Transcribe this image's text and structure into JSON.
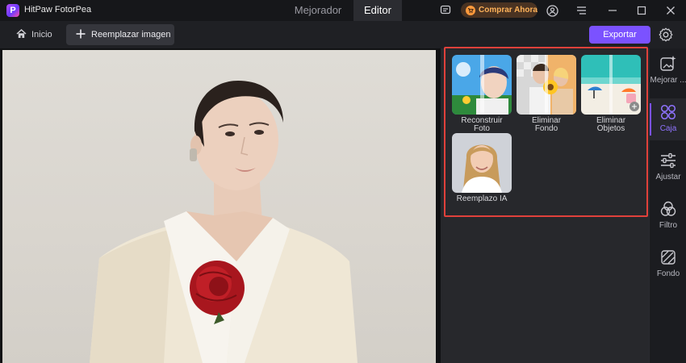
{
  "app": {
    "logo_letter": "P",
    "name": "HitPaw FotorPea"
  },
  "top_tabs": [
    {
      "label": "Mejorador",
      "active": false
    },
    {
      "label": "Editor",
      "active": true
    }
  ],
  "titlebar": {
    "buy_label": "Comprar Ahora"
  },
  "toolbar": {
    "home_label": "Inicio",
    "replace_label": "Reemplazar imagen",
    "export_label": "Exportar"
  },
  "tools": [
    {
      "line1": "Reconstruir",
      "line2": "Foto"
    },
    {
      "line1": "Eliminar",
      "line2": "Fondo"
    },
    {
      "line1": "Eliminar",
      "line2": "Objetos"
    },
    {
      "line1": "Reemplazo IA",
      "line2": ""
    }
  ],
  "sidebar": {
    "items": [
      {
        "label": "Mejorar ...",
        "icon": "enhance-icon",
        "active": false
      },
      {
        "label": "Caja",
        "icon": "box-icon",
        "active": true
      },
      {
        "label": "Ajustar",
        "icon": "adjust-icon",
        "active": false
      },
      {
        "label": "Filtro",
        "icon": "filter-icon",
        "active": false
      },
      {
        "label": "Fondo",
        "icon": "background-icon",
        "active": false
      }
    ]
  },
  "colors": {
    "accent": "#7b52ff",
    "highlight_border": "#e0413b",
    "buy_text": "#ffb35a"
  }
}
